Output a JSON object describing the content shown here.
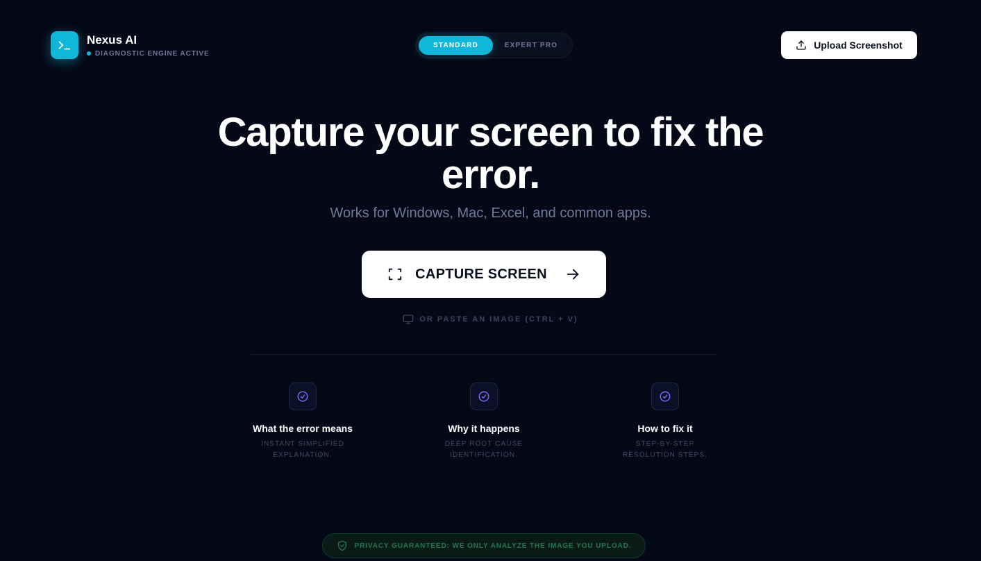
{
  "header": {
    "brand_name": "Nexus AI",
    "status_text": "DIAGNOSTIC ENGINE ACTIVE",
    "mode_toggle": {
      "standard": "STANDARD",
      "expert": "EXPERT PRO",
      "selected": "STANDARD"
    },
    "upload_label": "Upload Screenshot"
  },
  "hero": {
    "title": "Capture your screen to fix the error.",
    "subtitle": "Works for Windows, Mac, Excel, and common apps.",
    "capture_label": "CAPTURE SCREEN",
    "paste_hint": "OR PASTE AN IMAGE (CTRL + V)"
  },
  "features": [
    {
      "title": "What the error means",
      "desc": "INSTANT SIMPLIFIED EXPLANATION."
    },
    {
      "title": "Why it happens",
      "desc": "DEEP ROOT CAUSE IDENTIFICATION."
    },
    {
      "title": "How to fix it",
      "desc": "STEP-BY-STEP RESOLUTION STEPS."
    }
  ],
  "privacy_text": "PRIVACY GUARANTEED: WE ONLY ANALYZE THE IMAGE YOU UPLOAD.",
  "colors": {
    "background": "#050816",
    "accent": "#10b7d8",
    "feature_icon": "#6b6ff0",
    "privacy": "#1f7a55"
  },
  "icons": {
    "logo": "terminal-icon",
    "upload": "upload-icon",
    "capture": "screen-frame-icon",
    "arrow": "arrow-right-icon",
    "paste": "monitor-icon",
    "feature": "check-circle-icon",
    "privacy": "shield-check-icon"
  }
}
